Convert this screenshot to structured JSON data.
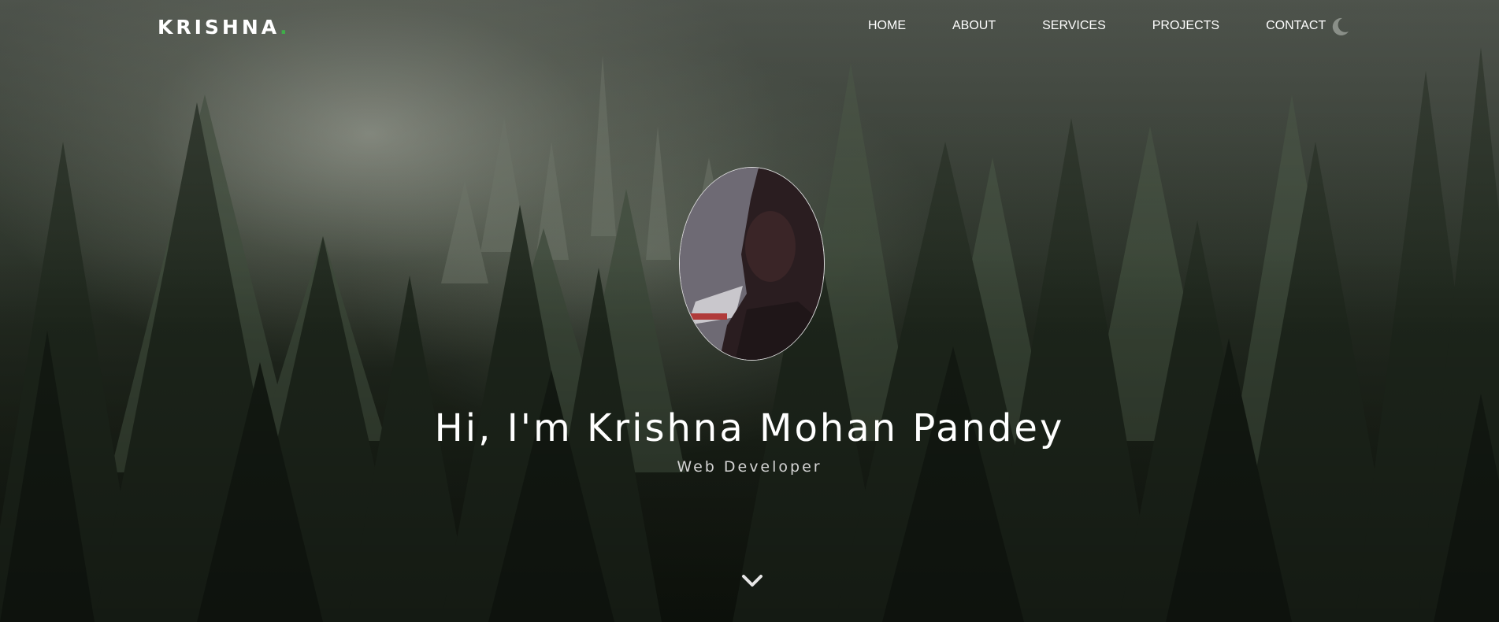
{
  "brand": {
    "name": "KRISHNA",
    "dot": ".",
    "accent_color": "#3fae49"
  },
  "nav": {
    "items": [
      {
        "label": "HOME"
      },
      {
        "label": "ABOUT"
      },
      {
        "label": "SERVICES"
      },
      {
        "label": "PROJECTS"
      },
      {
        "label": "CONTACT"
      }
    ],
    "theme_toggle_icon": "moon-icon"
  },
  "hero": {
    "title": "Hi, I'm Krishna Mohan Pandey",
    "subtitle": "Web Developer",
    "profile_image": "profile-photo",
    "scroll_icon": "chevron-down-icon",
    "background": "misty pine forest"
  }
}
